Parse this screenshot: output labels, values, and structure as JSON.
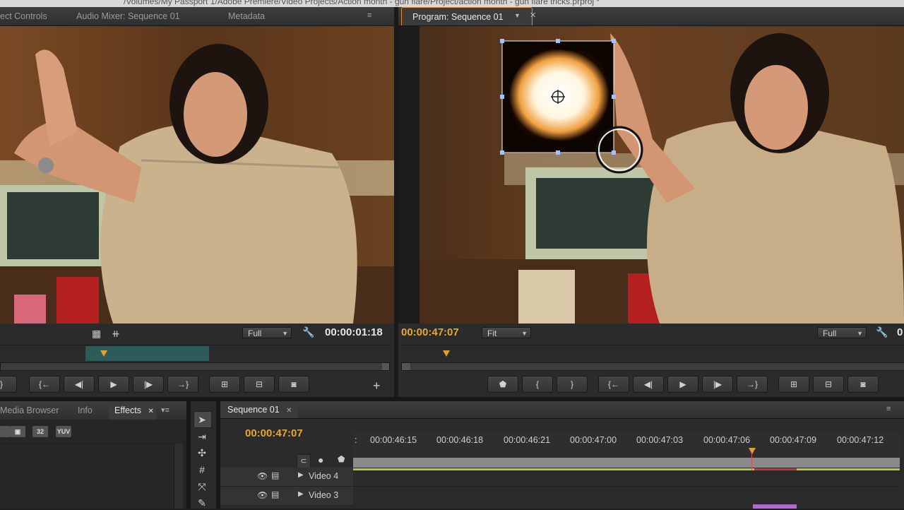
{
  "window": {
    "title": "/Volumes/My Passport 1/Adobe Premiere/Video Projects/Action month - gun flare/Project/action month - gun flare tricks.prproj *"
  },
  "source_panel": {
    "tabs": [
      "ect Controls",
      "Audio Mixer: Sequence 01",
      "Metadata"
    ],
    "menu_icon": "≡",
    "zoom": "Full",
    "timecode": "00:00:01:18",
    "transport": [
      "{",
      "{←",
      "◀|",
      "▶",
      "|▶",
      "→}",
      "insert",
      "overwrite",
      "camera"
    ],
    "add": "+"
  },
  "program_panel": {
    "tab": "Program: Sequence 01",
    "timecode": "00:00:47:07",
    "fit": "Fit",
    "zoom": "Full",
    "timecode_right": "0"
  },
  "effects_panel": {
    "tabs": [
      "Media Browser",
      "Info",
      "Effects"
    ],
    "icons": [
      "32",
      "YUV"
    ]
  },
  "timeline": {
    "tab": "Sequence 01",
    "timecode": "00:00:47:07",
    "ruler": [
      "00:00:46:15",
      "00:00:46:18",
      "00:00:46:21",
      "00:00:47:00",
      "00:00:47:03",
      "00:00:47:06",
      "00:00:47:09",
      "00:00:47:12"
    ],
    "tracks": [
      "Video 4",
      "Video 3"
    ]
  },
  "colors": {
    "accent_timecode": "#e8a72b",
    "panel_bg": "#2b2b2b",
    "border": "#161616"
  }
}
